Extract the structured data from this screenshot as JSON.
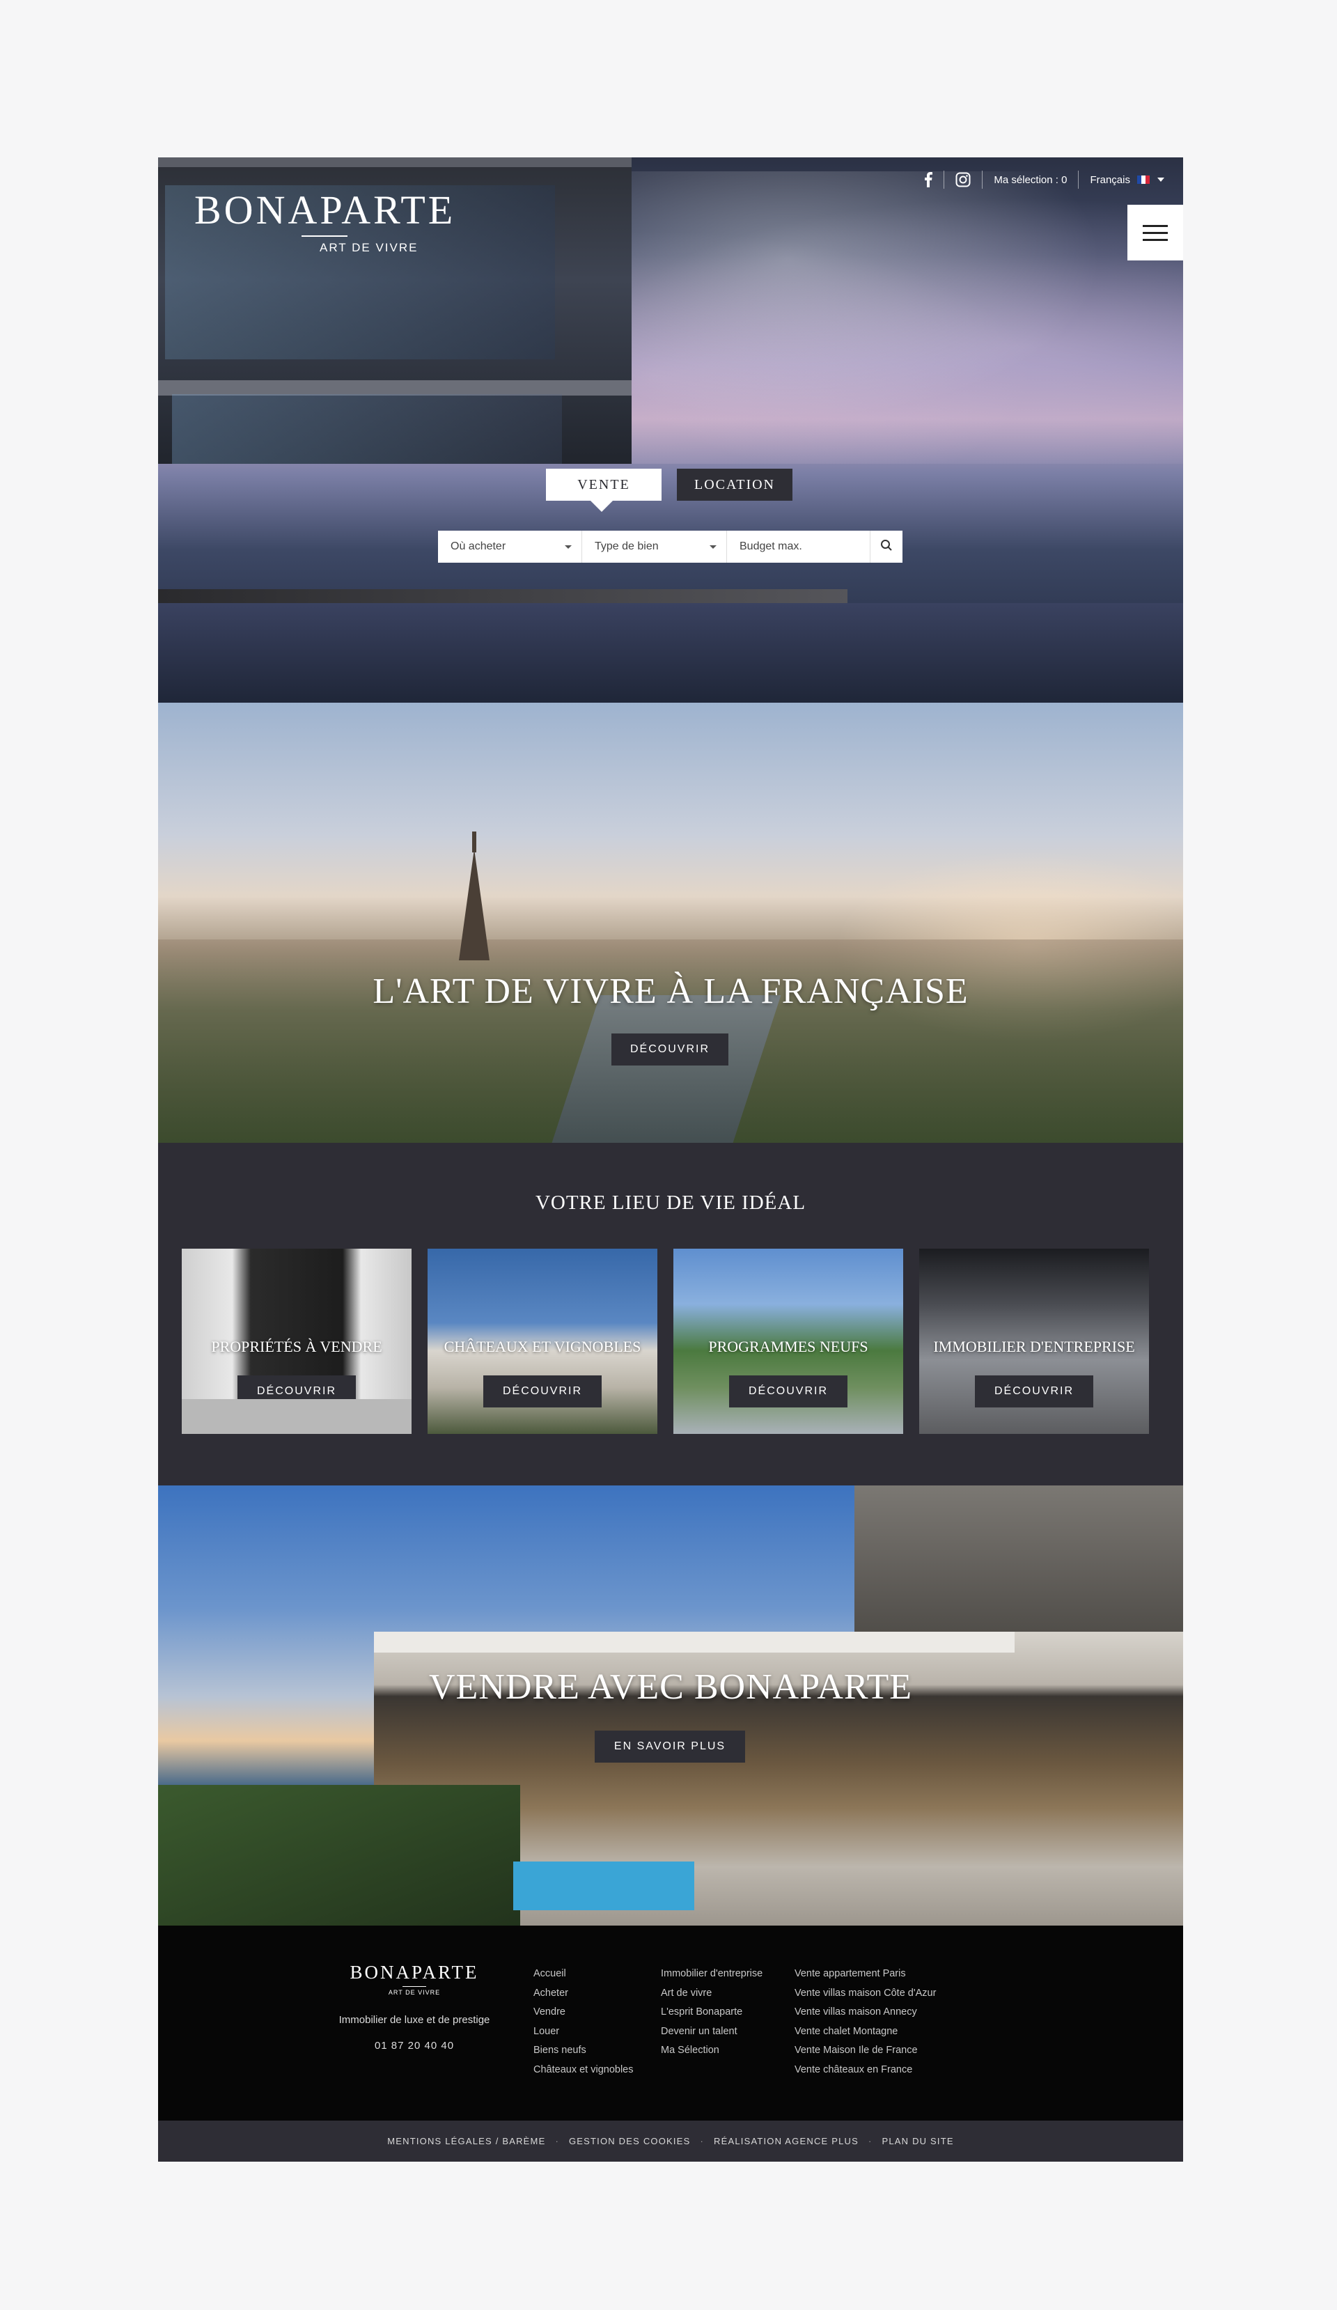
{
  "header": {
    "logo_name": "BONAPARTE",
    "logo_tagline": "ART DE VIVRE",
    "selection": "Ma sélection : 0",
    "language": "Français"
  },
  "search": {
    "tabs": [
      "VENTE",
      "LOCATION"
    ],
    "where_placeholder": "Où acheter",
    "type_placeholder": "Type de bien",
    "budget_placeholder": "Budget max."
  },
  "paris": {
    "title": "L'ART DE VIVRE À LA FRANÇAISE",
    "button": "DÉCOUVRIR"
  },
  "lieu": {
    "title": "VOTRE LIEU DE VIE IDÉAL",
    "cards": [
      {
        "title": "PROPRIÉTÉS À VENDRE",
        "button": "DÉCOUVRIR"
      },
      {
        "title": "CHÂTEAUX ET VIGNOBLES",
        "button": "DÉCOUVRIR"
      },
      {
        "title": "PROGRAMMES NEUFS",
        "button": "DÉCOUVRIR"
      },
      {
        "title": "IMMOBILIER D'ENTREPRISE",
        "button": "DÉCOUVRIR"
      }
    ]
  },
  "vendre": {
    "title": "VENDRE AVEC BONAPARTE",
    "button": "EN SAVOIR PLUS"
  },
  "footer": {
    "logo_name": "BONAPARTE",
    "logo_tagline": "ART DE VIVRE",
    "description": "Immobilier de luxe et de prestige",
    "phone": "01 87 20 40 40",
    "col1": [
      "Accueil",
      "Acheter",
      "Vendre",
      "Louer",
      "Biens neufs",
      "Châteaux et vignobles"
    ],
    "col2": [
      "Immobilier d'entreprise",
      "Art de vivre",
      "L'esprit Bonaparte",
      "Devenir un talent",
      "Ma Sélection"
    ],
    "col3": [
      "Vente appartement Paris",
      "Vente villas maison Côte d'Azur",
      "Vente villas maison Annecy",
      "Vente chalet Montagne",
      "Vente Maison Ile de France",
      "Vente châteaux en France"
    ],
    "legal": [
      "MENTIONS LÉGALES / BARÈME",
      "GESTION DES COOKIES",
      "RÉALISATION AGENCE PLUS",
      "PLAN DU SITE"
    ]
  }
}
